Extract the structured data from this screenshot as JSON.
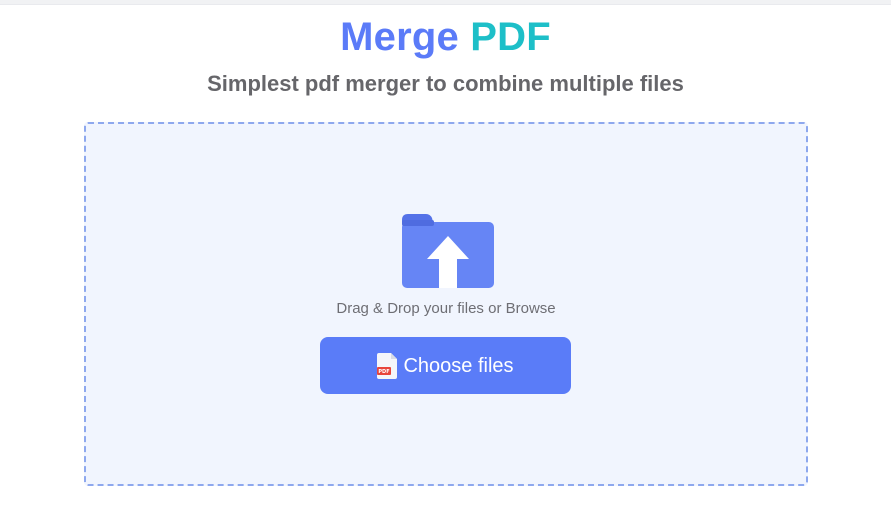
{
  "header": {
    "title_part1": "Merge",
    "title_part2": "PDF",
    "subtitle": "Simplest pdf merger to combine multiple files"
  },
  "dropzone": {
    "icon": "folder-upload-icon",
    "instruction": "Drag & Drop your files or Browse",
    "button": {
      "icon": "pdf-file-icon",
      "label": "Choose files"
    }
  },
  "colors": {
    "primary": "#5a7cf8",
    "accent_teal": "#1dbfc8",
    "dropzone_bg": "#f1f5fe",
    "dropzone_border": "#8ea8ee",
    "subtitle_text": "#66666a"
  }
}
